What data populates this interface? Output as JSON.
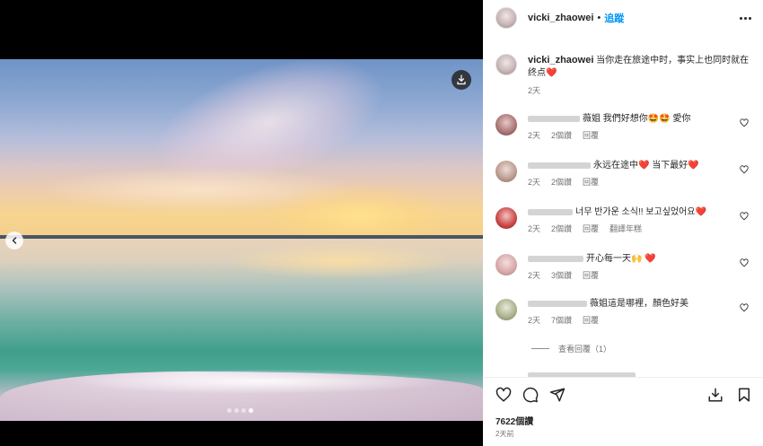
{
  "post": {
    "username": "vicki_zhaowei",
    "follow_label": "追蹤",
    "separator": "•"
  },
  "caption": {
    "username": "vicki_zhaowei",
    "text": "当你走在旅途中时，事实上也同时就在终点",
    "emoji": "❤️",
    "time": "2天"
  },
  "comments": [
    {
      "text": "薇姐 我們好想你🤩🤩 愛你",
      "time": "2天",
      "likes": "2個讚",
      "reply": "回覆",
      "translate": ""
    },
    {
      "text": "永远在途中❤️ 当下最好❤️",
      "time": "2天",
      "likes": "2個讚",
      "reply": "回覆",
      "translate": ""
    },
    {
      "text": "너무 반가운 소식!! 보고싶었어요❤️",
      "time": "2天",
      "likes": "2個讚",
      "reply": "回覆",
      "translate": "翻譯年糕"
    },
    {
      "text": "开心每一天🙌 ❤️",
      "time": "2天",
      "likes": "3個讚",
      "reply": "回覆",
      "translate": ""
    },
    {
      "text": "薇姐這是哪裡，顏色好美",
      "time": "2天",
      "likes": "7個讚",
      "reply": "回覆",
      "translate": ""
    }
  ],
  "view_replies": "查看回覆（1）",
  "likes_count": "7622個讚",
  "post_date": "2天前",
  "colors": {
    "accent": "#0095f6",
    "heart": "#e0245e",
    "muted": "#737373"
  },
  "icons": [
    "download-icon",
    "chevron-left-icon",
    "more-icon",
    "heart-icon",
    "comment-icon",
    "share-icon",
    "save-icon",
    "bookmark-icon"
  ]
}
